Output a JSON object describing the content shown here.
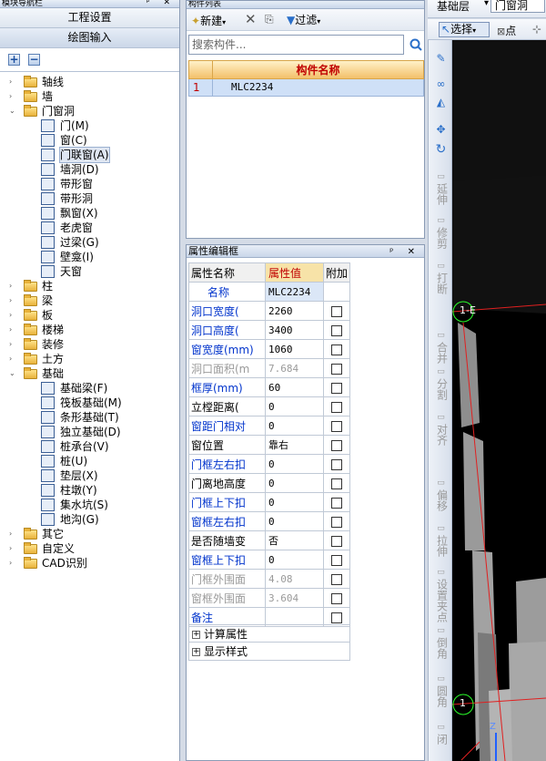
{
  "left_panel": {
    "title": "模块导航栏",
    "tabs": [
      "工程设置",
      "绘图输入"
    ],
    "tree": [
      {
        "label": "轴线",
        "level": 0,
        "exp": "+",
        "icon": "folder"
      },
      {
        "label": "墙",
        "level": 0,
        "exp": "+",
        "icon": "folder"
      },
      {
        "label": "门窗洞",
        "level": 0,
        "exp": "-",
        "icon": "folder-open"
      },
      {
        "label": "门(M)",
        "level": 1,
        "icon": "door-icon"
      },
      {
        "label": "窗(C)",
        "level": 1,
        "icon": "window-icon"
      },
      {
        "label": "门联窗(A)",
        "level": 1,
        "icon": "door-window-icon",
        "selected": true
      },
      {
        "label": "墙洞(D)",
        "level": 1,
        "icon": "wall-hole-icon"
      },
      {
        "label": "带形窗",
        "level": 1,
        "icon": "strip-window-icon"
      },
      {
        "label": "带形洞",
        "level": 1,
        "icon": "strip-hole-icon"
      },
      {
        "label": "飘窗(X)",
        "level": 1,
        "icon": "bay-window-icon"
      },
      {
        "label": "老虎窗",
        "level": 1,
        "icon": "dormer-icon"
      },
      {
        "label": "过梁(G)",
        "level": 1,
        "icon": "lintel-icon"
      },
      {
        "label": "壁龛(I)",
        "level": 1,
        "icon": "niche-icon"
      },
      {
        "label": "天窗",
        "level": 1,
        "icon": "skylight-icon"
      },
      {
        "label": "柱",
        "level": 0,
        "exp": "+",
        "icon": "folder"
      },
      {
        "label": "梁",
        "level": 0,
        "exp": "+",
        "icon": "folder"
      },
      {
        "label": "板",
        "level": 0,
        "exp": "+",
        "icon": "folder"
      },
      {
        "label": "楼梯",
        "level": 0,
        "exp": "+",
        "icon": "folder"
      },
      {
        "label": "装修",
        "level": 0,
        "exp": "+",
        "icon": "folder"
      },
      {
        "label": "土方",
        "level": 0,
        "exp": "+",
        "icon": "folder"
      },
      {
        "label": "基础",
        "level": 0,
        "exp": "-",
        "icon": "folder-open"
      },
      {
        "label": "基础梁(F)",
        "level": 1,
        "icon": "foundation-beam-icon"
      },
      {
        "label": "筏板基础(M)",
        "level": 1,
        "icon": "raft-foundation-icon"
      },
      {
        "label": "条形基础(T)",
        "level": 1,
        "icon": "strip-foundation-icon"
      },
      {
        "label": "独立基础(D)",
        "level": 1,
        "icon": "isolated-foundation-icon"
      },
      {
        "label": "桩承台(V)",
        "level": 1,
        "icon": "pile-cap-icon"
      },
      {
        "label": "桩(U)",
        "level": 1,
        "icon": "pile-icon"
      },
      {
        "label": "垫层(X)",
        "level": 1,
        "icon": "cushion-icon"
      },
      {
        "label": "柱墩(Y)",
        "level": 1,
        "icon": "column-pier-icon"
      },
      {
        "label": "集水坑(S)",
        "level": 1,
        "icon": "sump-icon"
      },
      {
        "label": "地沟(G)",
        "level": 1,
        "icon": "trench-icon"
      },
      {
        "label": "其它",
        "level": 0,
        "exp": "+",
        "icon": "folder"
      },
      {
        "label": "自定义",
        "level": 0,
        "exp": "+",
        "icon": "folder"
      },
      {
        "label": "CAD识别",
        "level": 0,
        "exp": "+",
        "icon": "folder"
      }
    ]
  },
  "component_list": {
    "title": "构件列表",
    "new_label": "新建",
    "filter_label": "过滤",
    "search_placeholder": "搜索构件...",
    "column_header": "构件名称",
    "rows": [
      {
        "index": "1",
        "name": "MLC2234"
      }
    ]
  },
  "property_panel": {
    "title": "属性编辑框",
    "headers": [
      "属性名称",
      "属性值",
      "附加"
    ],
    "rows": [
      {
        "name": "名称",
        "value": "MLC2234",
        "style": "blue",
        "check": false
      },
      {
        "name": "洞口宽度(",
        "value": "2260",
        "style": "blue",
        "check": true
      },
      {
        "name": "洞口高度(",
        "value": "3400",
        "style": "blue",
        "check": true
      },
      {
        "name": "窗宽度(mm)",
        "value": "1060",
        "style": "blue",
        "check": true
      },
      {
        "name": "洞口面积(m",
        "value": "7.684",
        "style": "grey",
        "check": true
      },
      {
        "name": "框厚(mm)",
        "value": "60",
        "style": "blue",
        "check": true
      },
      {
        "name": "立樘距离(",
        "value": "0",
        "style": "black",
        "check": true
      },
      {
        "name": "窗距门相对",
        "value": "0",
        "style": "blue",
        "check": true
      },
      {
        "name": "窗位置",
        "value": "靠右",
        "style": "black",
        "check": true
      },
      {
        "name": "门框左右扣",
        "value": "0",
        "style": "blue",
        "check": true
      },
      {
        "name": "门离地高度",
        "value": "0",
        "style": "black",
        "check": true
      },
      {
        "name": "门框上下扣",
        "value": "0",
        "style": "blue",
        "check": true
      },
      {
        "name": "窗框左右扣",
        "value": "0",
        "style": "blue",
        "check": true
      },
      {
        "name": "是否随墙变",
        "value": "否",
        "style": "black",
        "check": true
      },
      {
        "name": "窗框上下扣",
        "value": "0",
        "style": "blue",
        "check": true
      },
      {
        "name": "门框外围面",
        "value": "4.08",
        "style": "grey",
        "check": true
      },
      {
        "name": "窗框外围面",
        "value": "3.604",
        "style": "grey",
        "check": true
      },
      {
        "name": "备注",
        "value": "",
        "style": "blue",
        "check": true
      }
    ],
    "groups": [
      "计算属性",
      "显示样式"
    ]
  },
  "top_right": {
    "layer_label": "基础层",
    "category_label": "门窗洞",
    "select_label": "选择",
    "point_label": "点"
  },
  "vertical_tools": [
    "延伸",
    "修剪",
    "打断",
    "合并",
    "分割",
    "对齐",
    "偏移",
    "拉伸",
    "设置夹点",
    "倒角",
    "圆角",
    "闭"
  ],
  "canvas": {
    "axis_label": "1-E",
    "axis_marker": "1",
    "axis_z": "Z"
  },
  "colors": {
    "accent_blue": "#0033cc",
    "header_orange": "#f3c06a",
    "select_blue": "#cfe0f7"
  }
}
